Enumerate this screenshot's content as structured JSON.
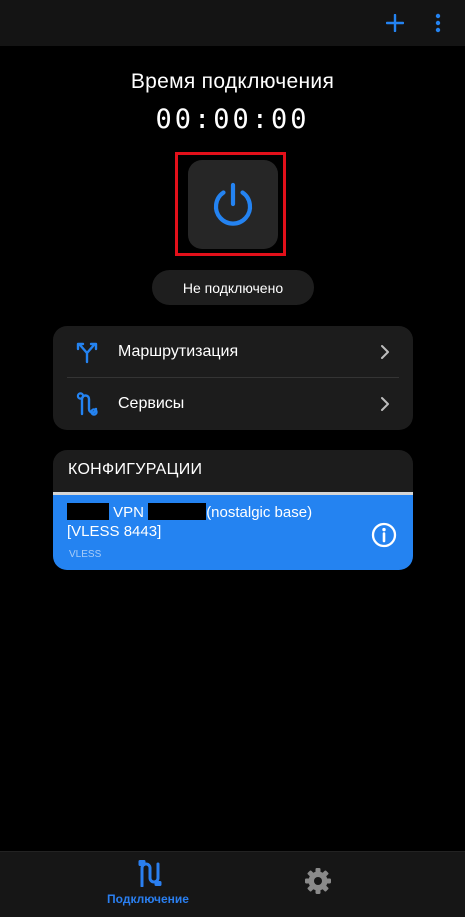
{
  "topbar": {
    "add_icon": "plus-icon",
    "more_icon": "more-vertical-icon"
  },
  "connection": {
    "title": "Время подключения",
    "timer": "00:00:00",
    "status": "Не подключено",
    "power_icon": "power-icon"
  },
  "menu": {
    "items": [
      {
        "label": "Маршрутизация",
        "icon": "routing-icon"
      },
      {
        "label": "Сервисы",
        "icon": "services-icon"
      }
    ]
  },
  "configs": {
    "header": "КОНФИГУРАЦИИ",
    "items": [
      {
        "name_part1": "VPN",
        "name_part2": "(nostalgic base) [VLESS 8443]",
        "protocol": "VLESS"
      }
    ]
  },
  "bottom_nav": {
    "items": [
      {
        "label": "Подключение",
        "icon": "connection-icon",
        "active": true
      },
      {
        "label": "",
        "icon": "gear-icon",
        "active": false
      }
    ]
  },
  "colors": {
    "accent": "#2483f1",
    "background": "#000000",
    "card": "#1c1c1c",
    "highlight_frame": "#e3101a"
  }
}
